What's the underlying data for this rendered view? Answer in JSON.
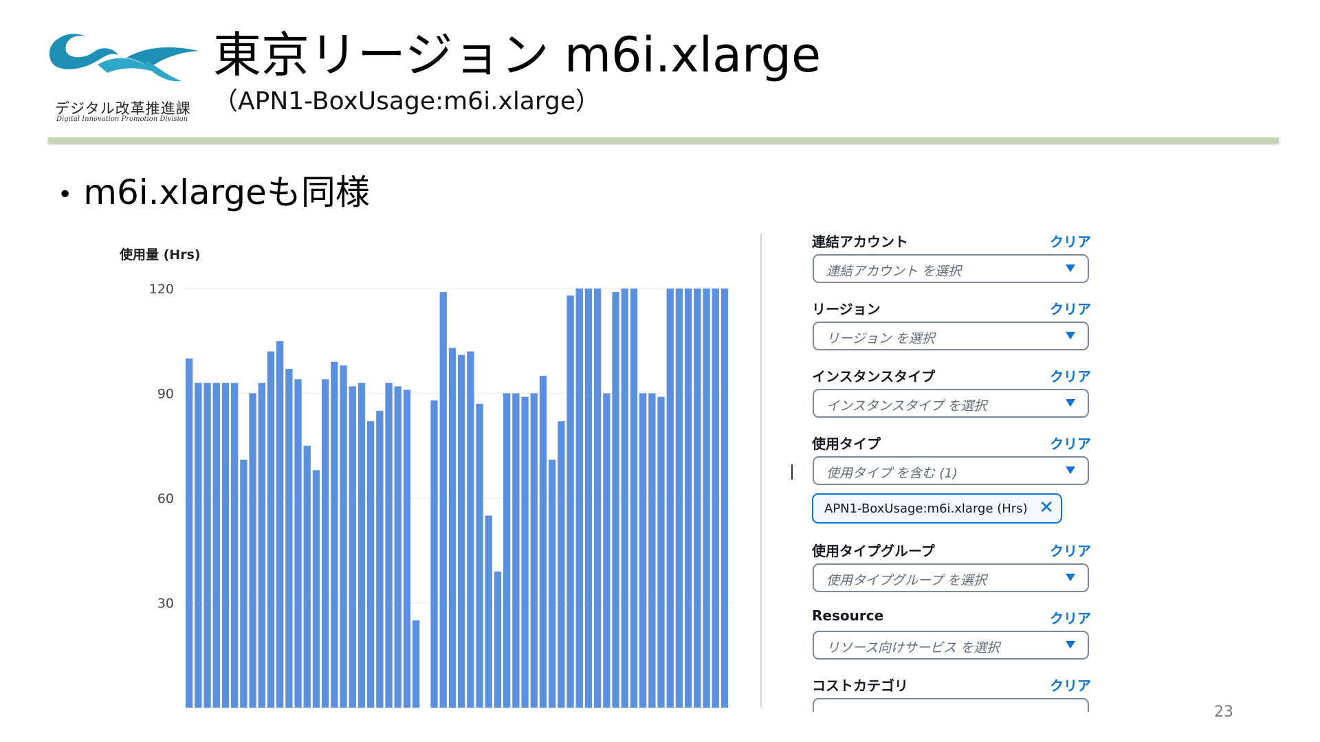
{
  "slide": {
    "title": "東京リージョン m6i.xlarge",
    "subtitle": "（APN1-BoxUsage:m6i.xlarge）",
    "bullet": "m6i.xlargeも同様",
    "page_number": "23"
  },
  "logo": {
    "name_jp": "デジタル改革推進課",
    "name_en": "Digital Innovation Promotion Division",
    "colors": {
      "primary": "#1e8fb5",
      "secondary": "#2fa7c9"
    }
  },
  "chart_data": {
    "type": "bar",
    "ylabel": "使用量 (Hrs)",
    "yticks": [
      30,
      60,
      90,
      120
    ],
    "ylim": [
      0,
      120
    ],
    "grid": true,
    "bar_color": "#5b8fe0",
    "values": [
      100,
      93,
      93,
      93,
      93,
      93,
      71,
      90,
      93,
      102,
      105,
      97,
      94,
      75,
      68,
      94,
      99,
      98,
      92,
      93,
      82,
      85,
      93,
      92,
      91,
      25,
      null,
      88,
      119,
      103,
      101,
      102,
      87,
      55,
      39,
      90,
      90,
      89,
      90,
      95,
      71,
      82,
      118,
      120,
      120,
      120,
      90,
      119,
      120,
      120,
      90,
      90,
      89,
      120,
      120,
      120,
      120,
      120,
      120,
      120
    ]
  },
  "filters": {
    "clear_label": "クリア",
    "items": [
      {
        "label": "連結アカウント",
        "placeholder": "連結アカウント を選択"
      },
      {
        "label": "リージョン",
        "placeholder": "リージョン を選択"
      },
      {
        "label": "インスタンスタイプ",
        "placeholder": "インスタンスタイプ を選択"
      },
      {
        "label": "使用タイプ",
        "placeholder": "使用タイプ を含む (1)"
      },
      {
        "label": "使用タイプグループ",
        "placeholder": "使用タイプグループ を選択"
      },
      {
        "label": "Resource",
        "placeholder": "リソース向けサービス を選択"
      },
      {
        "label": "コストカテゴリ",
        "placeholder": ""
      }
    ],
    "selected_token": "APN1-BoxUsage:m6i.xlarge (Hrs)",
    "accent_color": "#0972d3"
  }
}
